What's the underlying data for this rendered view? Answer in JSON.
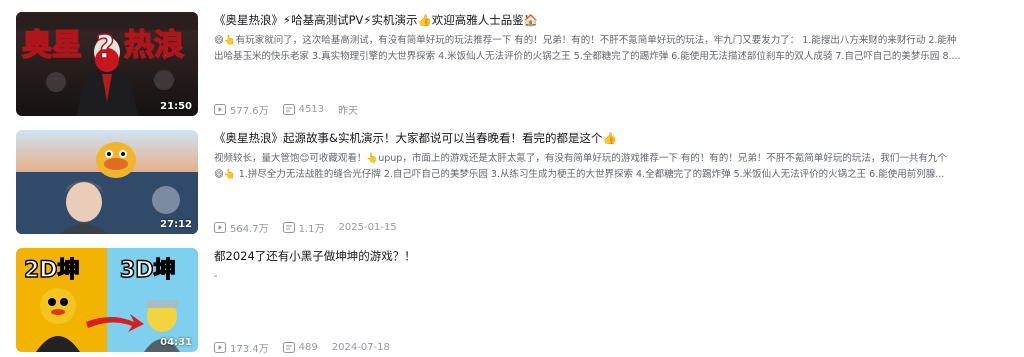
{
  "videos": [
    {
      "title": "《奥星热浪》⚡哈基高测试PV⚡实机演示👍欢迎高雅人士品鉴🏠",
      "desc_line1": "😄👆有玩家就问了，这次哈基高测试，有没有简单好玩的玩法推荐一下 有的！兄弟！有的！不肝不氪简单好玩的玩法，牢九门又要发力了： 1.能搜出八方来财的来财行动 2.能种",
      "desc_line2": "出哈基玉米的快乐老家 3.真实物理引擎的大世界探索 4.米饭仙人无法评价的火锅之王 5.全都糖完了的踢炸弹 6.能使用无法描述部位刹车的双人成骑 7.自己吓自己的美梦乐园 8....",
      "thumb_text_left": "奥星",
      "thumb_text_right": "热浪",
      "thumb_text_mid": "?",
      "duration": "21:50",
      "views": "577.6万",
      "comments": "4513",
      "date": "昨天"
    },
    {
      "title": "《奥星热浪》起源故事&实机演示！大家都说可以当春晚看！看完的都是这个👍",
      "desc_line1": "视频较长，量大管饱😊可收藏观看！👆upup，市面上的游戏还是太肝太氪了，有没有简单好玩的游戏推荐一下 有的！有的！兄弟！不肝不氪简单好玩的玩法，我们一共有九个",
      "desc_line2": "😄👆 1.拼尽全力无法战胜的缝合光仔牌 2.自己吓自己的美梦乐园 3.从练习生成为梗王的大世界探索 4.全都糖完了的踢炸弹 5.米饭仙人无法评价的火锅之王 6.能使用前列腺...",
      "duration": "27:12",
      "views": "564.7万",
      "comments": "1.1万",
      "date": "2025-01-15"
    },
    {
      "title": "都2024了还有小黑子做坤坤的游戏？！",
      "desc_line1": "-",
      "desc_line2": "",
      "thumb_text_left": "2D坤",
      "thumb_text_right": "3D坤",
      "duration": "04:31",
      "views": "173.4万",
      "comments": "489",
      "date": "2024-07-18"
    }
  ],
  "icons": {
    "views": "play-count-icon",
    "comments": "danmaku-icon"
  }
}
